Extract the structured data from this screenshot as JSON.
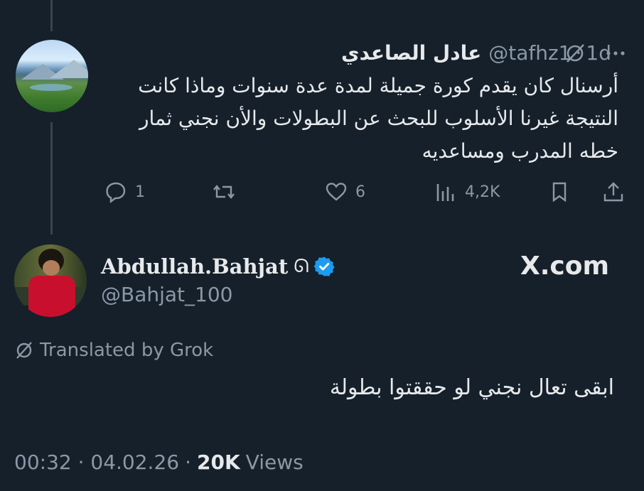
{
  "reply_tweet": {
    "display_name": "عادل الصاعدي",
    "handle": "@tafhz1",
    "separator": "·",
    "time": "1d",
    "text": "أرسنال كان يقدم كورة جميلة لمدة عدة سنوات وماذا كانت النتيجة غيرنا الأسلوب للبحث عن البطولات والأن نجني ثمار خطه المدرب ومساعديه",
    "actions": {
      "replies": "1",
      "retweets": "",
      "likes": "6",
      "views": "4,2K"
    },
    "icons": [
      "grok-icon",
      "more-icon",
      "reply-icon",
      "retweet-icon",
      "like-icon",
      "views-icon",
      "bookmark-icon",
      "share-icon"
    ]
  },
  "main_tweet": {
    "display_name": "Abdullah.Bahjat",
    "name_emoji": "ᘏ",
    "handle": "@Bahjat_100",
    "verified": true,
    "verified_color": "#1d9bf0",
    "watermark": "X.com",
    "translated_label": "Translated by Grok",
    "text": "ابقى تعال نجني لو حققتوا بطولة",
    "timestamp": "00:32 · 04.02.26",
    "separator": "·",
    "views_count": "20K",
    "views_label": "Views"
  },
  "colors": {
    "background": "#15202b",
    "text_primary": "#e7e9ea",
    "text_secondary": "#8b98a5",
    "thread_line": "#38444d"
  }
}
